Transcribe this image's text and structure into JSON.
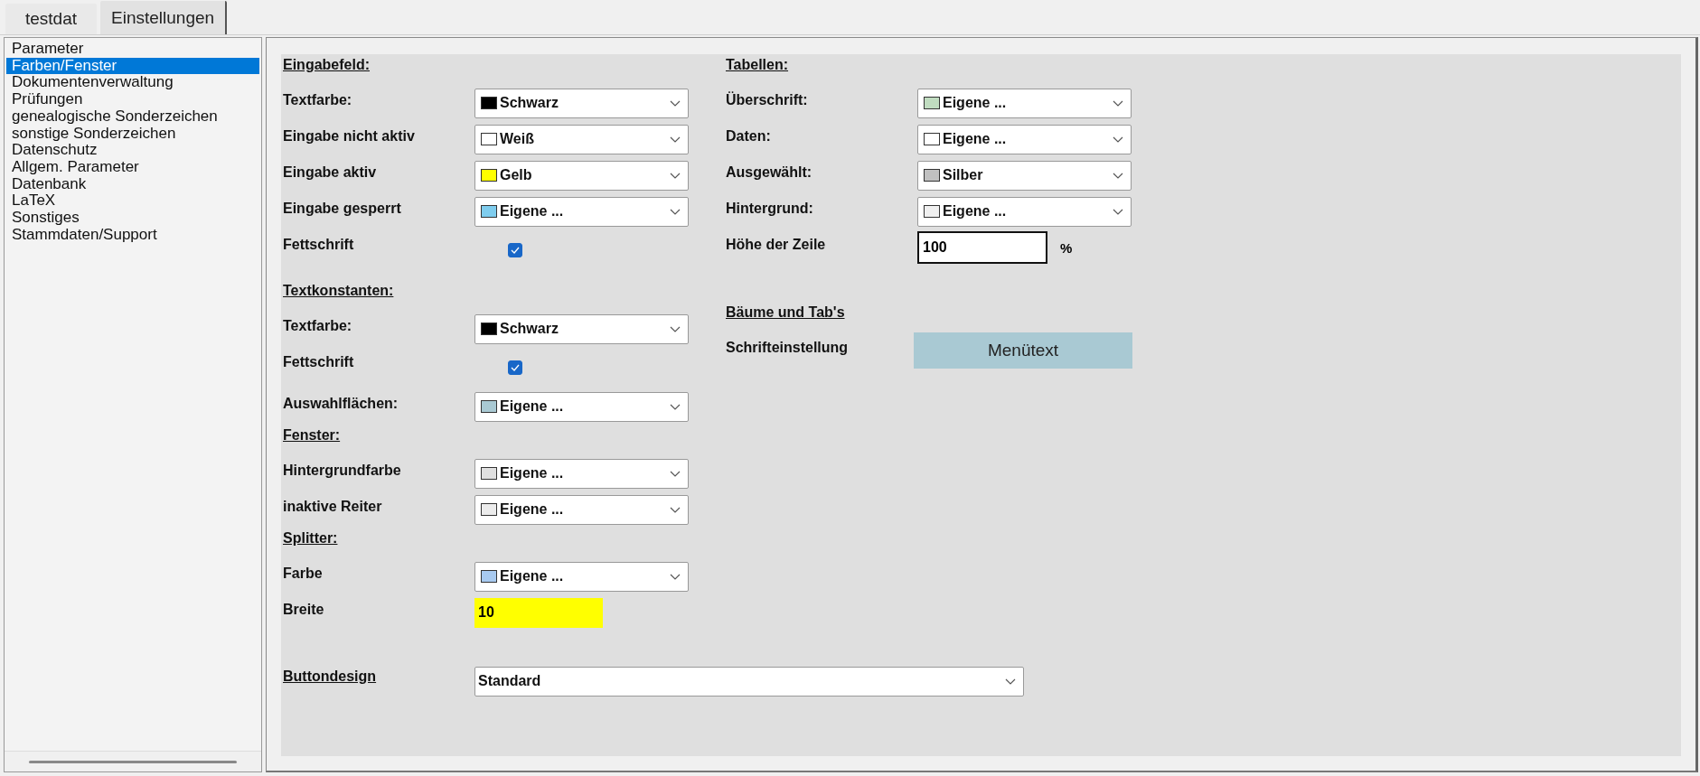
{
  "tabs": [
    {
      "label": "testdat",
      "selected": false
    },
    {
      "label": "Einstellungen",
      "selected": true
    }
  ],
  "sidebar": {
    "items": [
      {
        "label": "Parameter",
        "selected": false
      },
      {
        "label": "Farben/Fenster",
        "selected": true
      },
      {
        "label": "Dokumentenverwaltung",
        "selected": false
      },
      {
        "label": "Prüfungen",
        "selected": false
      },
      {
        "label": "genealogische Sonderzeichen",
        "selected": false
      },
      {
        "label": "sonstige Sonderzeichen",
        "selected": false
      },
      {
        "label": "Datenschutz",
        "selected": false
      },
      {
        "label": "Allgem. Parameter",
        "selected": false
      },
      {
        "label": "Datenbank",
        "selected": false
      },
      {
        "label": "LaTeX",
        "selected": false
      },
      {
        "label": "Sonstiges",
        "selected": false
      },
      {
        "label": "Stammdaten/Support",
        "selected": false
      }
    ]
  },
  "left_column": [
    {
      "heading": "Eingabefeld:",
      "rows": [
        {
          "kind": "select",
          "label": "Textfarbe:",
          "value": "Schwarz",
          "color": "#000000"
        },
        {
          "kind": "select",
          "label": "Eingabe nicht aktiv",
          "value": "Weiß",
          "color": "#ffffff"
        },
        {
          "kind": "select",
          "label": "Eingabe aktiv",
          "value": "Gelb",
          "color": "#ffff00"
        },
        {
          "kind": "select",
          "label": "Eingabe gesperrt",
          "value": "Eigene ...",
          "color": "#7fcdee"
        },
        {
          "kind": "checkbox",
          "label": "Fettschrift",
          "checked": true
        }
      ]
    },
    {
      "heading": "Textkonstanten:",
      "rows": [
        {
          "kind": "select",
          "label": "Textfarbe:",
          "value": "Schwarz",
          "color": "#000000"
        },
        {
          "kind": "checkbox",
          "label": "Fettschrift",
          "checked": true
        },
        {
          "kind": "select",
          "label": "Auswahlflächen:",
          "value": "Eigene ...",
          "color": "#a9c9d3"
        }
      ]
    },
    {
      "heading": "Fenster:",
      "rows": [
        {
          "kind": "select",
          "label": "Hintergrundfarbe",
          "value": "Eigene ...",
          "color": "#e0e0e0"
        },
        {
          "kind": "select",
          "label": "inaktive Reiter",
          "value": "Eigene ...",
          "color": "#ececec"
        }
      ]
    },
    {
      "heading": "Splitter:",
      "rows": [
        {
          "kind": "select",
          "label": "Farbe",
          "value": "Eigene ...",
          "color": "#a8caf0"
        },
        {
          "kind": "input",
          "label": "Breite",
          "value": "10",
          "focused": true
        }
      ]
    }
  ],
  "button_design": {
    "label": "Buttondesign",
    "value": "Standard"
  },
  "right_column": [
    {
      "heading": "Tabellen:",
      "rows": [
        {
          "kind": "select",
          "label": "Überschrift:",
          "value": "Eigene ...",
          "color": "#c0dcc0"
        },
        {
          "kind": "select",
          "label": "Daten:",
          "value": "Eigene ...",
          "color": "#ffffff"
        },
        {
          "kind": "select",
          "label": "Ausgewählt:",
          "value": "Silber",
          "color": "#c0c0c0"
        },
        {
          "kind": "select",
          "label": "Hintergrund:",
          "value": "Eigene ...",
          "color": "#f0f0f0"
        },
        {
          "kind": "input",
          "label": "Höhe der Zeile",
          "value": "100",
          "focused": false,
          "unit": "%"
        }
      ]
    },
    {
      "heading": "Bäume und Tab's",
      "rows": [
        {
          "kind": "button",
          "label": "Schrifteinstellung",
          "value": "Menütext"
        }
      ]
    }
  ]
}
